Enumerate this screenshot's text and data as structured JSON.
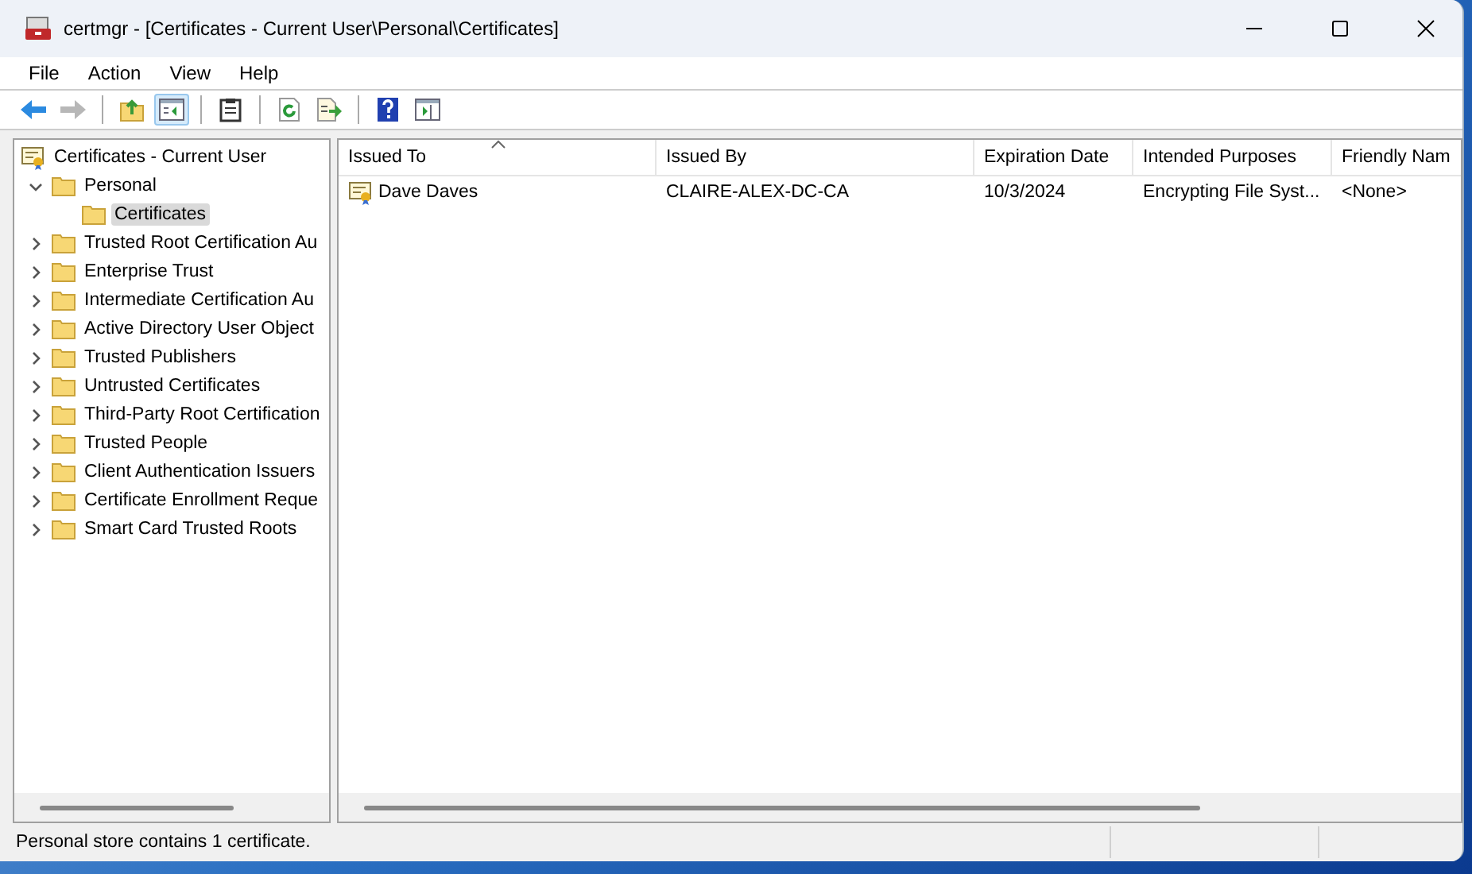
{
  "window": {
    "title": "certmgr - [Certificates - Current User\\Personal\\Certificates]"
  },
  "menu": [
    "File",
    "Action",
    "View",
    "Help"
  ],
  "toolbar": [
    {
      "kind": "back",
      "disabled": false,
      "pressed": false
    },
    {
      "kind": "forward",
      "disabled": true,
      "pressed": false
    },
    {
      "kind": "sep"
    },
    {
      "kind": "up",
      "disabled": false,
      "pressed": false
    },
    {
      "kind": "tree",
      "disabled": false,
      "pressed": true
    },
    {
      "kind": "sep"
    },
    {
      "kind": "clipboard",
      "disabled": false,
      "pressed": false
    },
    {
      "kind": "sep"
    },
    {
      "kind": "refresh",
      "disabled": false,
      "pressed": false
    },
    {
      "kind": "export",
      "disabled": false,
      "pressed": false
    },
    {
      "kind": "sep"
    },
    {
      "kind": "help",
      "disabled": false,
      "pressed": false
    },
    {
      "kind": "pane",
      "disabled": false,
      "pressed": false
    }
  ],
  "tree": {
    "label": "Certificates - Current User",
    "children": [
      {
        "label": "Personal",
        "expanded": true,
        "selected": false,
        "children": [
          {
            "label": "Certificates",
            "selected": true
          }
        ]
      },
      {
        "label": "Trusted Root Certification Au",
        "expanded": false,
        "selected": false
      },
      {
        "label": "Enterprise Trust",
        "expanded": false,
        "selected": false
      },
      {
        "label": "Intermediate Certification Au",
        "expanded": false,
        "selected": false
      },
      {
        "label": "Active Directory User Object",
        "expanded": false,
        "selected": false
      },
      {
        "label": "Trusted Publishers",
        "expanded": false,
        "selected": false
      },
      {
        "label": "Untrusted Certificates",
        "expanded": false,
        "selected": false
      },
      {
        "label": "Third-Party Root Certification",
        "expanded": false,
        "selected": false
      },
      {
        "label": "Trusted People",
        "expanded": false,
        "selected": false
      },
      {
        "label": "Client Authentication Issuers",
        "expanded": false,
        "selected": false
      },
      {
        "label": "Certificate Enrollment Reque",
        "expanded": false,
        "selected": false
      },
      {
        "label": "Smart Card Trusted Roots",
        "expanded": false,
        "selected": false
      }
    ]
  },
  "table": {
    "columns": [
      {
        "label": "Issued To",
        "sorted": true
      },
      {
        "label": "Issued By",
        "sorted": false
      },
      {
        "label": "Expiration Date",
        "sorted": false
      },
      {
        "label": "Intended Purposes",
        "sorted": false
      },
      {
        "label": "Friendly Nam",
        "sorted": false
      }
    ],
    "rows": [
      {
        "cells": [
          "Dave Daves",
          "CLAIRE-ALEX-DC-CA",
          "10/3/2024",
          "Encrypting File Syst...",
          "<None>"
        ]
      }
    ]
  },
  "status_bar": {
    "text": "Personal store contains 1 certificate."
  }
}
